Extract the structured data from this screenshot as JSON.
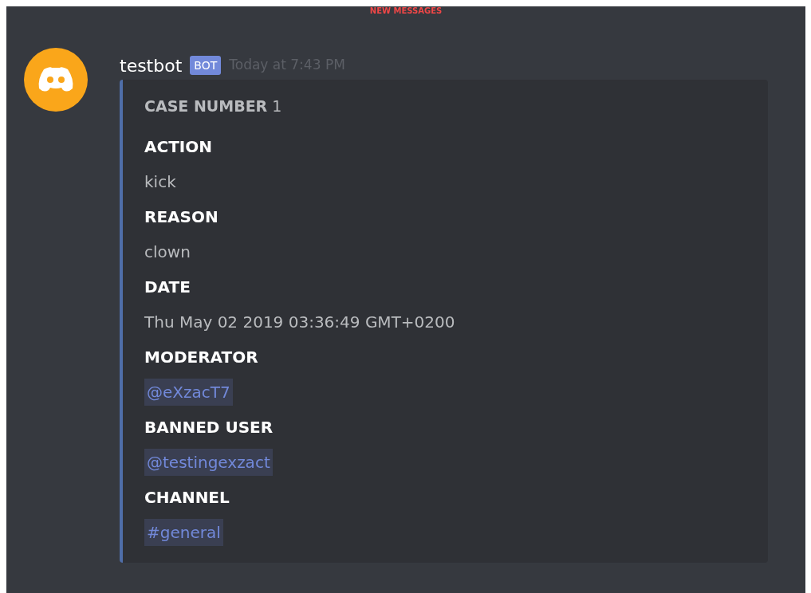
{
  "divider": {
    "label": "NEW MESSAGES"
  },
  "message": {
    "author": "testbot",
    "badge": "BOT",
    "timestamp": "Today at 7:43 PM",
    "embed": {
      "title": "**CASE NUMBER** 1",
      "fields": [
        {
          "name": "ACTION",
          "value": "kick",
          "kind": "text"
        },
        {
          "name": "REASON",
          "value": "clown",
          "kind": "text"
        },
        {
          "name": "DATE",
          "value": "Thu May 02 2019 03:36:49 GMT+0200",
          "kind": "text"
        },
        {
          "name": "MODERATOR",
          "value": "@eXzacT7",
          "kind": "mention"
        },
        {
          "name": "BANNED USER",
          "value": "@testingexzact",
          "kind": "mention"
        },
        {
          "name": "CHANNEL",
          "value": "#general",
          "kind": "mention"
        }
      ]
    }
  }
}
